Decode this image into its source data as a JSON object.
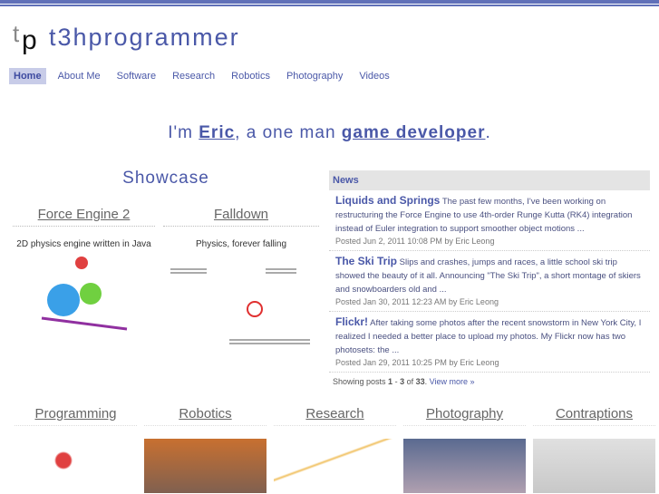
{
  "header": {
    "logo_text": "tp",
    "title": "t3hprogrammer"
  },
  "nav": [
    "Home",
    "About Me",
    "Software",
    "Research",
    "Robotics",
    "Photography",
    "Videos"
  ],
  "tagline": {
    "pre": "I'm ",
    "name": "Eric",
    "mid": ", a one man ",
    "role": "game developer",
    "post": "."
  },
  "showcase": {
    "title": "Showcase",
    "cards": [
      {
        "title": "Force Engine 2",
        "desc": "2D physics engine written in Java"
      },
      {
        "title": "Falldown",
        "desc": "Physics, forever falling"
      }
    ]
  },
  "news": {
    "title": "News",
    "items": [
      {
        "title": "Liquids and Springs",
        "body": "The past few months, I've been working on restructuring the Force Engine to use 4th-order Runge Kutta (RK4) integration instead of Euler integration to support smoother object motions ...",
        "meta": "Posted Jun 2, 2011 10:08 PM by Eric Leong"
      },
      {
        "title": "The Ski Trip",
        "body": "Slips and crashes, jumps and races, a little school ski trip showed the beauty of it all. Announcing \"The Ski Trip\", a short montage of skiers and snowboarders old and ...",
        "meta": "Posted Jan 30, 2011 12:23 AM by Eric Leong"
      },
      {
        "title": "Flickr!",
        "body": "After taking some photos after the recent snowstorm in New York City, I realized I needed a better place to upload my photos. My Flickr now has two photosets: the ...",
        "meta": "Posted Jan 29, 2011 10:25 PM by Eric Leong"
      }
    ],
    "showing_pre": "Showing posts ",
    "range_start": "1",
    "range_sep": " - ",
    "range_end": "3",
    "of": " of ",
    "total": "33",
    "after": ". ",
    "view_more": "View more »"
  },
  "categories": [
    "Programming",
    "Robotics",
    "Research",
    "Photography",
    "Contraptions"
  ]
}
